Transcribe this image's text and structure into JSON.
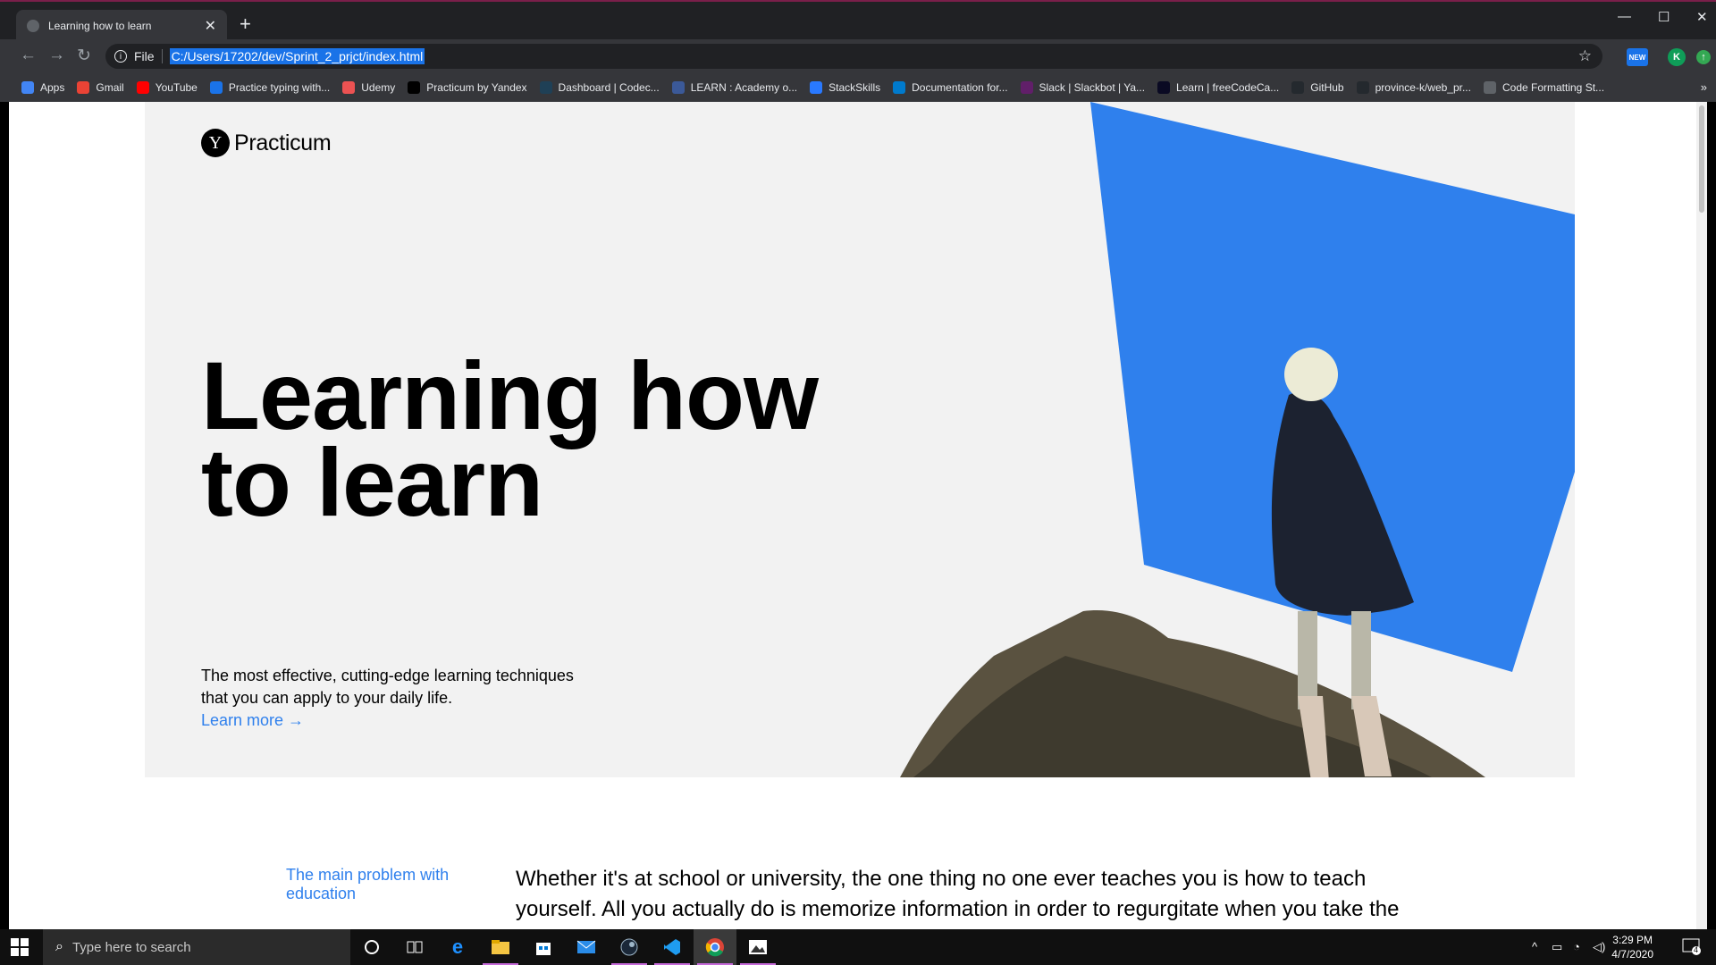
{
  "browser": {
    "tab_title": "Learning how to learn",
    "url_scheme": "File",
    "url": "C:/Users/17202/dev/Sprint_2_prjct/index.html",
    "new_badge": "NEW",
    "profile_initial": "K"
  },
  "bookmarks": [
    {
      "label": "Apps",
      "icon": "apps-grid-icon",
      "color": "#4285f4"
    },
    {
      "label": "Gmail",
      "icon": "gmail-icon",
      "color": "#ea4335"
    },
    {
      "label": "YouTube",
      "icon": "youtube-icon",
      "color": "#ff0000"
    },
    {
      "label": "Practice typing with...",
      "icon": "typing-icon",
      "color": "#1a73e8"
    },
    {
      "label": "Udemy",
      "icon": "udemy-icon",
      "color": "#ec5252"
    },
    {
      "label": "Practicum by Yandex",
      "icon": "practicum-icon",
      "color": "#000000"
    },
    {
      "label": "Dashboard | Codec...",
      "icon": "codecademy-icon",
      "color": "#1f4056"
    },
    {
      "label": "LEARN : Academy o...",
      "icon": "learn-academy-icon",
      "color": "#3b5998"
    },
    {
      "label": "StackSkills",
      "icon": "stackskills-icon",
      "color": "#2979ff"
    },
    {
      "label": "Documentation for...",
      "icon": "vscode-icon",
      "color": "#007acc"
    },
    {
      "label": "Slack | Slackbot | Ya...",
      "icon": "slack-icon",
      "color": "#611f69"
    },
    {
      "label": "Learn | freeCodeCa...",
      "icon": "freecodecamp-icon",
      "color": "#0a0a23"
    },
    {
      "label": "GitHub",
      "icon": "github-icon",
      "color": "#24292e"
    },
    {
      "label": "province-k/web_pr...",
      "icon": "github-icon",
      "color": "#24292e"
    },
    {
      "label": "Code Formatting St...",
      "icon": "globe-icon",
      "color": "#5f6368"
    }
  ],
  "page": {
    "logo_mark": "Y",
    "logo_text": "Practicum",
    "hero_title_line1": "Learning how",
    "hero_title_line2": "to learn",
    "hero_subtitle": "The most effective, cutting-edge learning techniques that you can apply to your daily life.",
    "hero_link": "Learn more →",
    "section_label": "The main problem with education",
    "section_text": "Whether it's at school or university, the one thing no one ever teaches you is how to teach yourself. All you actually do is memorize information in order to regurgitate when you take the",
    "accent_color": "#2f80ed",
    "hero_bg": "#f2f2f2"
  },
  "taskbar": {
    "search_placeholder": "Type here to search",
    "time": "3:29 PM",
    "date": "4/7/2020",
    "notification_count": "4",
    "pinned": [
      "cortana-icon",
      "task-view-icon",
      "edge-icon",
      "file-explorer-icon",
      "store-icon",
      "mail-icon",
      "steam-icon",
      "vscode-icon",
      "chrome-icon",
      "photos-icon"
    ]
  }
}
